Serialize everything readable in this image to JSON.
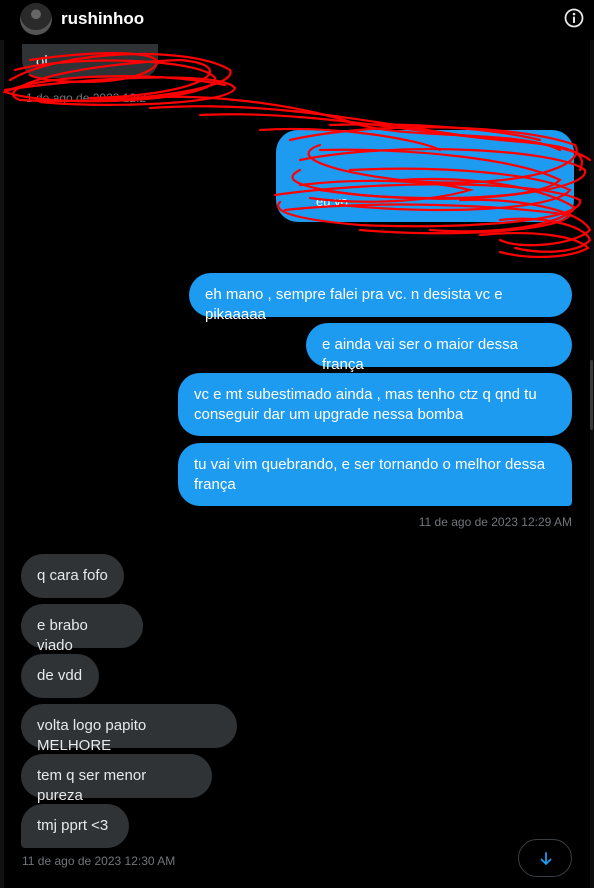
{
  "header": {
    "username": "rushinhoo",
    "avatar_icon": "user-avatar",
    "info_icon": "info-icon"
  },
  "redacted": {
    "top_bubble_fragment": "ol ",
    "top_timestamp_fragment": "1 de ago de 2023 12:2",
    "blue_bubble_fragment": "eu vo"
  },
  "messages_out": [
    "eh mano , sempre falei pra vc. n desista vc e pikaaaaa",
    "e ainda vai ser o maior dessa frança",
    "vc e mt subestimado ainda , mas tenho ctz q qnd tu conseguir dar um upgrade nessa bomba",
    "tu vai vim quebrando,  e ser tornando o melhor dessa frança"
  ],
  "timestamp_out": "11 de ago de 2023 12:29 AM",
  "messages_in": [
    "q cara fofo",
    "e brabo viado",
    "de vdd",
    "volta logo papito MELHORE",
    "tem q ser menor pureza",
    "tmj pprt <3"
  ],
  "timestamp_in": "11 de ago de 2023 12:30 AM",
  "scroll_down_icon": "arrow-down-icon",
  "colors": {
    "background": "#000000",
    "outgoing_bubble": "#1d9bf0",
    "incoming_bubble": "#2f3336",
    "timestamp": "#71767b",
    "scribble": "#ff0000"
  }
}
